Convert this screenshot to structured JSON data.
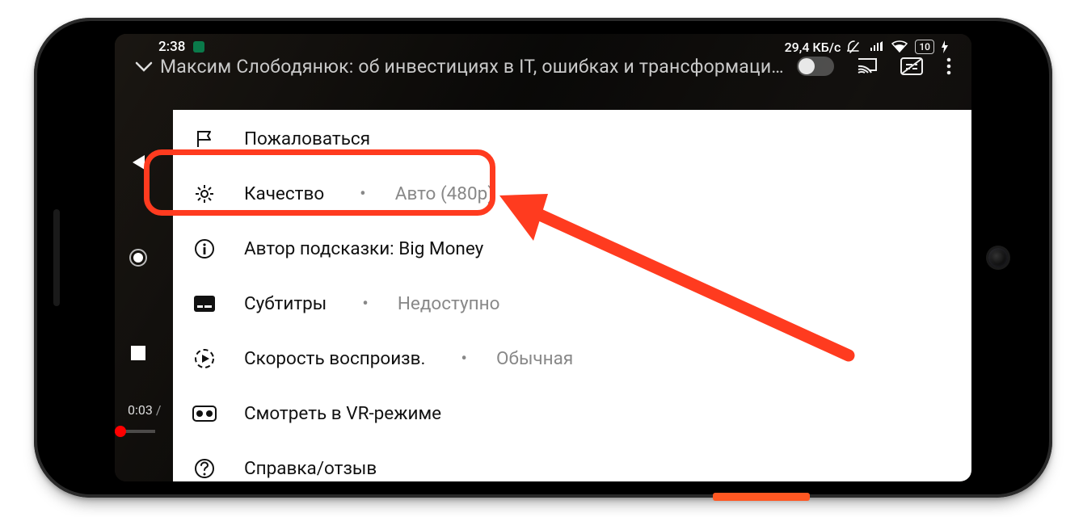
{
  "status_bar": {
    "time": "2:38",
    "network_speed": "29,4 КБ/с",
    "battery_pct": "10"
  },
  "video": {
    "title": "Максим Слободянюк: об инвестициях в IT, ошибках и трансформациях …",
    "elapsed": "0:03",
    "total_suffix": "/"
  },
  "menu": {
    "report": "Пожаловаться",
    "quality_label": "Качество",
    "quality_value": "Авто (480p)",
    "cards_author_prefix": "Автор подсказки:",
    "cards_author_name": "Big Money",
    "captions_label": "Субтитры",
    "captions_value": "Недоступно",
    "speed_label": "Скорость воспроизв.",
    "speed_value": "Обычная",
    "vr": "Смотреть в VR-режиме",
    "help": "Справка/отзыв"
  }
}
